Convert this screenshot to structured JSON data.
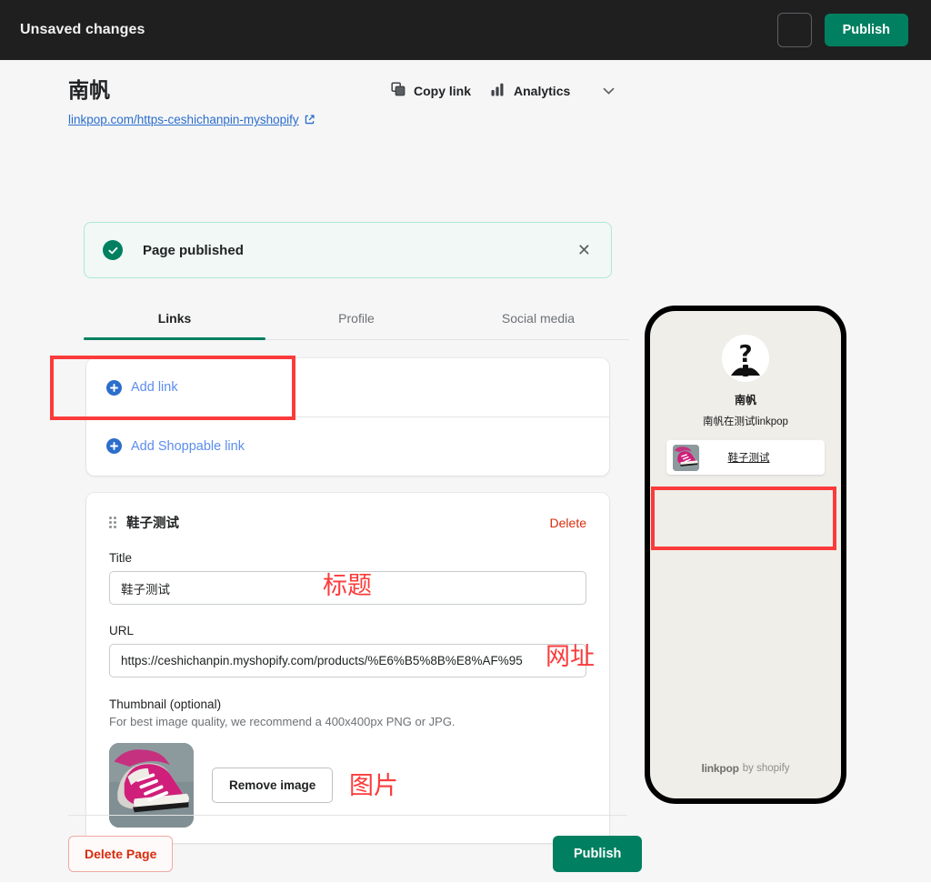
{
  "topbar": {
    "status_label": "Unsaved changes",
    "icon_button_name": "preview-icon-button",
    "publish_label": "Publish",
    "publish_color": "#008060",
    "background": "#1f1f1f"
  },
  "header": {
    "page_title": "南帆",
    "page_url": "linkpop.com/https-ceshichanpin-myshopify",
    "external_link_icon": "external-link-icon",
    "actions": [
      {
        "label": "Copy link",
        "icon": "copy-icon"
      },
      {
        "label": "Analytics",
        "icon": "bar-chart-icon"
      }
    ],
    "caret_icon": "chevron-down-icon"
  },
  "banner": {
    "icon": "check-circle-icon",
    "message": "Page published",
    "close_icon": "close-icon",
    "background": "#f1f8f5",
    "border": "#aee9d1",
    "accent": "#008060"
  },
  "tabs": [
    {
      "label": "Links",
      "active": true
    },
    {
      "label": "Profile",
      "active": false
    },
    {
      "label": "Social media",
      "active": false
    }
  ],
  "add_card": {
    "rows": [
      {
        "label": "Add link",
        "icon": "plus-circle-icon"
      },
      {
        "label": "Add Shoppable link",
        "icon": "plus-circle-icon"
      }
    ],
    "link_color": "#5b8def"
  },
  "link_item": {
    "drag_handle_icon": "drag-handle-icon",
    "name": "鞋子测试",
    "delete_label": "Delete",
    "delete_color": "#d72c0d",
    "title_label": "Title",
    "title_value": "鞋子测试",
    "title_placeholder": "Title",
    "url_label": "URL",
    "url_value": "https://ceshichanpin.myshopify.com/products/%E6%B5%8B%E8%AF%95",
    "url_placeholder": "URL",
    "thumbnail_label": "Thumbnail (optional)",
    "thumbnail_help": "For best image quality, we recommend a 400x400px PNG or JPG.",
    "thumbnail_image_name": "pink-sneakers-thumbnail",
    "remove_image_label": "Remove image"
  },
  "footer": {
    "delete_page_label": "Delete Page",
    "publish_label": "Publish"
  },
  "preview": {
    "avatar_icon": "unknown-person-avatar",
    "name": "南帆",
    "bio": "南帆在测试linkpop",
    "link": {
      "text": "鞋子测试",
      "thumbnail_name": "pink-sneakers-thumbnail"
    },
    "brand": "linkpop",
    "brand_suffix": "by shopify"
  },
  "annotations": {
    "color": "#fb3b3b",
    "title_note": "标题",
    "url_note": "网址",
    "image_note": "图片",
    "box_add_link": "add-link-highlight",
    "box_preview_link": "preview-link-highlight"
  }
}
